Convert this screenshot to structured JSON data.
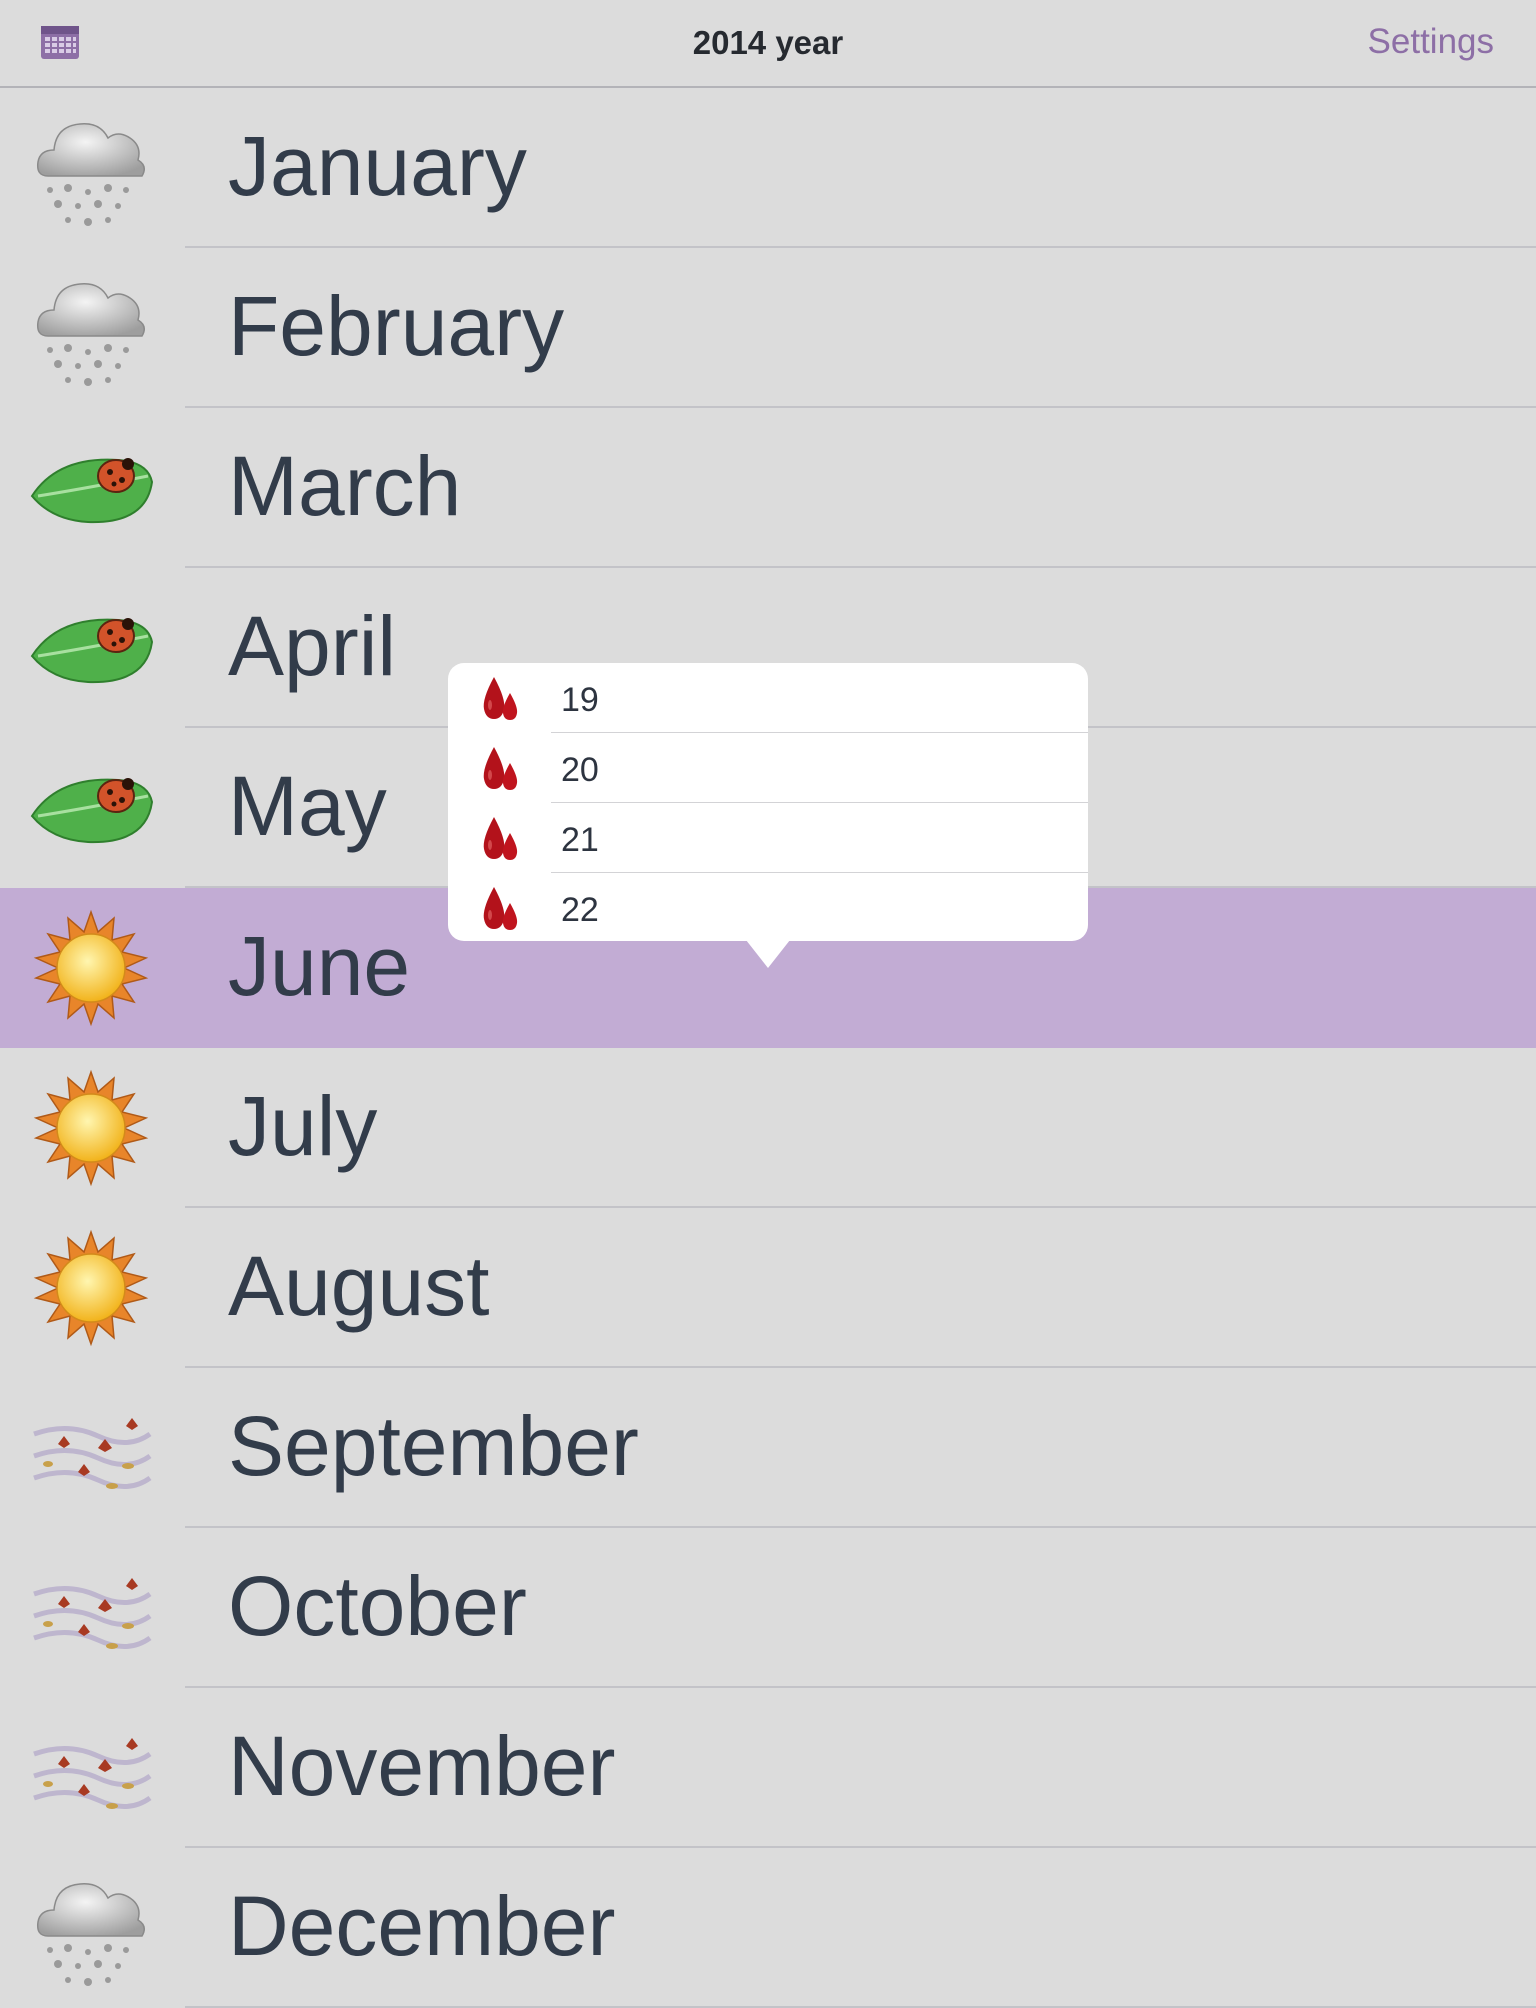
{
  "header": {
    "calendar_icon": "calendar-icon",
    "title": "2014 year",
    "settings_label": "Settings"
  },
  "months": [
    {
      "label": "January",
      "icon": "snow-cloud-icon"
    },
    {
      "label": "February",
      "icon": "snow-cloud-icon"
    },
    {
      "label": "March",
      "icon": "ladybug-leaf-icon"
    },
    {
      "label": "April",
      "icon": "ladybug-leaf-icon"
    },
    {
      "label": "May",
      "icon": "ladybug-leaf-icon"
    },
    {
      "label": "June",
      "icon": "sun-icon",
      "selected": true
    },
    {
      "label": "July",
      "icon": "sun-icon"
    },
    {
      "label": "August",
      "icon": "sun-icon"
    },
    {
      "label": "September",
      "icon": "autumn-wind-icon"
    },
    {
      "label": "October",
      "icon": "autumn-wind-icon"
    },
    {
      "label": "November",
      "icon": "autumn-wind-icon"
    },
    {
      "label": "December",
      "icon": "snow-cloud-icon"
    }
  ],
  "popover": {
    "items": [
      {
        "label": "19",
        "icon": "blood-drops-icon"
      },
      {
        "label": "20",
        "icon": "blood-drops-icon"
      },
      {
        "label": "21",
        "icon": "blood-drops-icon"
      },
      {
        "label": "22",
        "icon": "blood-drops-icon"
      }
    ]
  },
  "colors": {
    "background": "#dcdcdc",
    "selected_row": "#c2acd4",
    "accent": "#8d6fa6",
    "text": "#323c4a",
    "drop_red": "#b3121b"
  }
}
